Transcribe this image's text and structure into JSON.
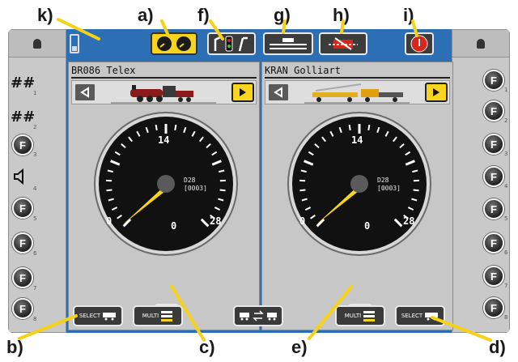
{
  "callouts": {
    "a": "a)",
    "b": "b)",
    "c": "c)",
    "d": "d)",
    "e": "e)",
    "f": "f)",
    "g": "g)",
    "h": "h)",
    "i": "i)",
    "k": "k)"
  },
  "left_panel": {
    "loco_name": "BR086 Telex",
    "dial": {
      "ticks": [
        "0",
        "14",
        "28"
      ],
      "speed": "0",
      "protocol": "D28",
      "address": "[0003]"
    }
  },
  "right_panel": {
    "loco_name": "KRAN Golliart",
    "dial": {
      "ticks": [
        "0",
        "14",
        "28"
      ],
      "speed": "0",
      "protocol": "D28",
      "address": "[0003]"
    }
  },
  "left_functions": [
    {
      "type": "symbol",
      "symbol": "##",
      "number": "1"
    },
    {
      "type": "symbol",
      "symbol": "##",
      "number": "2"
    },
    {
      "type": "key",
      "label": "F",
      "number": "3"
    },
    {
      "type": "speaker",
      "number": "4"
    },
    {
      "type": "key",
      "label": "F",
      "number": "5"
    },
    {
      "type": "key",
      "label": "F",
      "number": "6"
    },
    {
      "type": "key",
      "label": "F",
      "number": "7"
    },
    {
      "type": "key",
      "label": "F",
      "number": "8"
    }
  ],
  "right_functions": [
    {
      "label": "F",
      "number": "1"
    },
    {
      "label": "F",
      "number": "2"
    },
    {
      "label": "F",
      "number": "3"
    },
    {
      "label": "F",
      "number": "4"
    },
    {
      "label": "F",
      "number": "5"
    },
    {
      "label": "F",
      "number": "6"
    },
    {
      "label": "F",
      "number": "7"
    },
    {
      "label": "F",
      "number": "8"
    }
  ],
  "bottom_bar": {
    "select_left": "SELECT",
    "multi_left": "MULTI",
    "multi_right": "MULTI",
    "select_right": "SELECT"
  },
  "colors": {
    "screen_blue": "#2d6fb4",
    "highlight_yellow": "#f7d51c",
    "callout_line": "#f5d217",
    "stop_red": "#d9261c"
  },
  "icons": {
    "top_bar": [
      "battery-icon",
      "dual-dial-icon",
      "signal-switch-icon",
      "track-icon",
      "loco-red-icon",
      "stop-icon"
    ]
  }
}
